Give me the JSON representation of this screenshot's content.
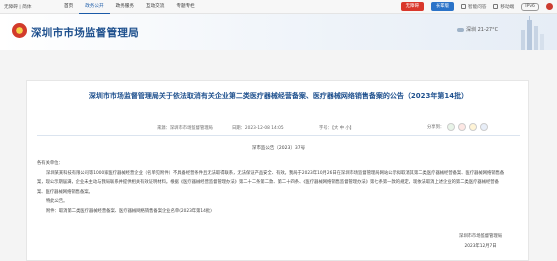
{
  "topbar": {
    "left": "无障碍 | 简体",
    "nav": [
      {
        "label": "首页",
        "active": false
      },
      {
        "label": "政务公开",
        "active": true
      },
      {
        "label": "政务服务",
        "active": false
      },
      {
        "label": "互动交流",
        "active": false
      },
      {
        "label": "专题专栏",
        "active": false
      }
    ],
    "pill_red": "无障碍",
    "pill_blue": "长辈版",
    "tool1": "智能问答",
    "tool2": "移动端",
    "ipv": "IPv6"
  },
  "header": {
    "title": "深圳市市场监督管理局",
    "weather": "深圳 21-27°C"
  },
  "article": {
    "title": "深圳市市场监督管理局关于依法取消有关企业第二类医疗器械经营备案、医疗器械网络销售备案的公告（2023年第14批）",
    "source": "来源：深圳市市场监督管理局",
    "date": "日期：2023-12-08 14:05",
    "fontsize": "字号：【大 中 小】",
    "share_label": "分享到：",
    "doc_no": "深市监公告〔2023〕37号",
    "salutation": "各有关单位：",
    "paragraphs": [
      "深圳某某科技有限公司等1000家医疗器械经营企业（名单见附件）不具备经营条件且无法取得联系，无法保证产品安全、有效。我局于2023年10月26日在深圳市场监督管理局网站公示拟取消其第二类医疗器械经营备案、医疗器械网络销售备案，现公示期届满，企业未主动与我局联系并提供相关有效证明材料。根据《医疗器械经营监督管理办法》第二十二条第二款、第二十四条、《医疗器械网络销售监督管理办法》第七条第一款的规定，现依法取消上述企业的第二类医疗器械经营备案、医疗器械网络销售备案。",
      "特此公告。",
      "附件：取消第二类医疗器械经营备案、医疗器械网络销售备案企业名单(2023年第14批)"
    ],
    "signer": "深圳市市场监督管理局",
    "sign_date": "2023年12月7日"
  }
}
